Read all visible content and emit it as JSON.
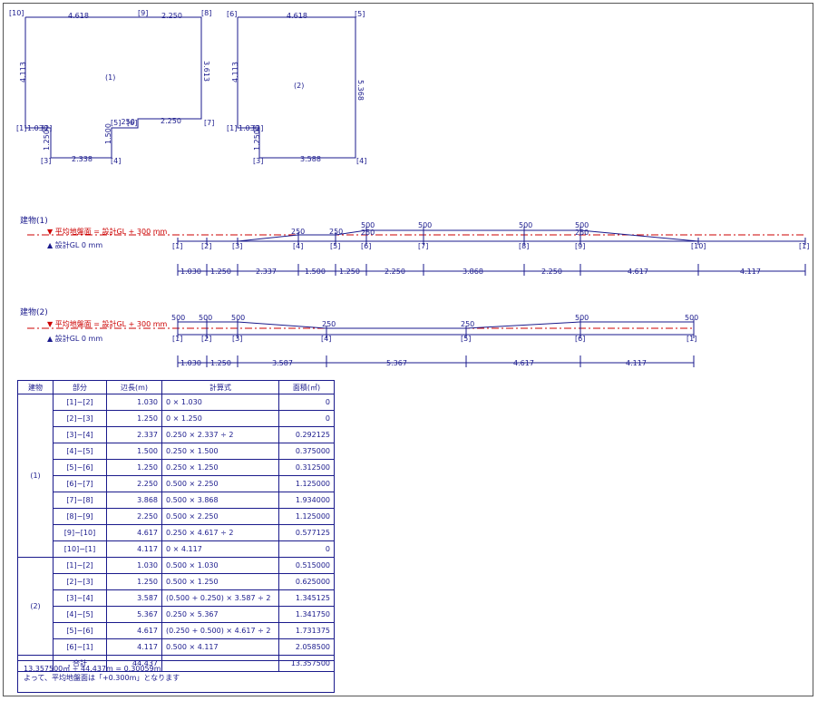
{
  "plan1": {
    "label": "(1)",
    "dims": {
      "top_left": "4.618",
      "top_right": "2.250",
      "left": "4.113",
      "right": "3.613",
      "bottom_left": "1.030",
      "notch_left": "1.250",
      "notch_bottom": "2.338",
      "notch_right": "1.500",
      "step_mid": ".250",
      "step_right": "2.250"
    },
    "points": [
      "[10]",
      "[9]",
      "[8]",
      "[7]",
      "[6]",
      "[5]",
      "[4]",
      "[3]",
      "[2]",
      "[1]"
    ]
  },
  "plan2": {
    "label": "(2)",
    "dims": {
      "top": "4.618",
      "right": "5.368",
      "left": "4.113",
      "bottom_left": "1.030",
      "small_left": "1.250",
      "bottom": "3.588"
    },
    "points": [
      "[6]",
      "[5]",
      "[4]",
      "[3]",
      "[2]",
      "[1]"
    ]
  },
  "elev1": {
    "title": "建物(1)",
    "ground_label": "▼ 平均地盤面 = 設計GL + 300 mm",
    "design_label": "▲ 設計GL 0 mm",
    "heights": [
      "250",
      "250",
      "500",
      "500",
      "500",
      "500",
      "250",
      "250"
    ],
    "points": [
      "[1]",
      "[2]",
      "[3]",
      "[4]",
      "[5]",
      "[6]",
      "[7]",
      "[8]",
      "[9]",
      "[10]",
      "[1]"
    ],
    "spans": [
      "1.030",
      "1.250",
      "2.337",
      "1.500",
      "1.250",
      "2.250",
      "3.868",
      "2.250",
      "4.617",
      "4.117"
    ]
  },
  "elev2": {
    "title": "建物(2)",
    "ground_label": "▼ 平均地盤面 = 設計GL + 300 mm",
    "design_label": "▲ 設計GL 0 mm",
    "heights": [
      "500",
      "500",
      "500",
      "250",
      "250",
      "500",
      "500"
    ],
    "points": [
      "[1]",
      "[2]",
      "[3]",
      "[4]",
      "[5]",
      "[6]",
      "[1]"
    ],
    "spans": [
      "1.030",
      "1.250",
      "3.587",
      "5.367",
      "4.617",
      "4.117"
    ]
  },
  "table": {
    "headers": [
      "建物",
      "部分",
      "辺長(m)",
      "計算式",
      "面積(㎡)"
    ],
    "groups": [
      {
        "name": "(1)",
        "rows": [
          [
            "[1]−[2]",
            "1.030",
            "0 × 1.030",
            "0"
          ],
          [
            "[2]−[3]",
            "1.250",
            "0 × 1.250",
            "0"
          ],
          [
            "[3]−[4]",
            "2.337",
            "0.250 × 2.337 ÷ 2",
            "0.292125"
          ],
          [
            "[4]−[5]",
            "1.500",
            "0.250 × 1.500",
            "0.375000"
          ],
          [
            "[5]−[6]",
            "1.250",
            "0.250 × 1.250",
            "0.312500"
          ],
          [
            "[6]−[7]",
            "2.250",
            "0.500 × 2.250",
            "1.125000"
          ],
          [
            "[7]−[8]",
            "3.868",
            "0.500 × 3.868",
            "1.934000"
          ],
          [
            "[8]−[9]",
            "2.250",
            "0.500 × 2.250",
            "1.125000"
          ],
          [
            "[9]−[10]",
            "4.617",
            "0.250 × 4.617 ÷ 2",
            "0.577125"
          ],
          [
            "[10]−[1]",
            "4.117",
            "0 × 4.117",
            "0"
          ]
        ]
      },
      {
        "name": "(2)",
        "rows": [
          [
            "[1]−[2]",
            "1.030",
            "0.500 × 1.030",
            "0.515000"
          ],
          [
            "[2]−[3]",
            "1.250",
            "0.500 × 1.250",
            "0.625000"
          ],
          [
            "[3]−[4]",
            "3.587",
            "(0.500 + 0.250) × 3.587 ÷ 2",
            "1.345125"
          ],
          [
            "[4]−[5]",
            "5.367",
            "0.250 × 5.367",
            "1.341750"
          ],
          [
            "[5]−[6]",
            "4.617",
            "(0.250 + 0.500) × 4.617 ÷ 2",
            "1.731375"
          ],
          [
            "[6]−[1]",
            "4.117",
            "0.500 × 4.117",
            "2.058500"
          ]
        ]
      }
    ],
    "total": {
      "label": "合計",
      "length": "44.437",
      "area": "13.357500"
    },
    "footer_line1": "13.357500㎡ ÷ 44.437m = 0.30059m",
    "footer_line2": "よって、平均地盤面は「+0.300m」となります"
  },
  "colors": {
    "line": "#1a1a8c",
    "ground": "#cc0000"
  }
}
